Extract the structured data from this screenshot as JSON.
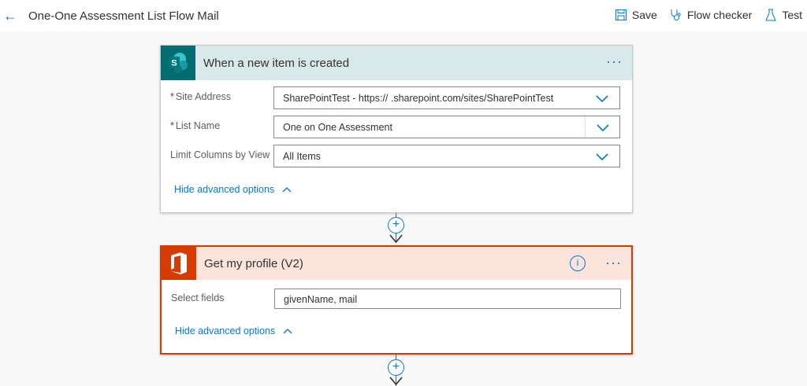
{
  "header": {
    "title": "One-One Assessment List Flow Mail",
    "save": "Save",
    "flow_checker": "Flow checker",
    "test": "Test"
  },
  "trigger": {
    "title": "When a new item is created",
    "more": "···",
    "fields": [
      {
        "label": "Site Address",
        "required": "*",
        "value": "SharePointTest - https://                  .sharepoint.com/sites/SharePointTest"
      },
      {
        "label": "List Name",
        "required": "*",
        "value": "One on One Assessment"
      },
      {
        "label": "Limit Columns by View",
        "value": "All Items"
      }
    ],
    "hide_advanced": "Hide advanced options"
  },
  "action": {
    "title": "Get my profile (V2)",
    "info": "i",
    "more": "···",
    "fields": [
      {
        "label": "Select fields",
        "value": "givenName, mail"
      }
    ],
    "hide_advanced": "Hide advanced options"
  },
  "colors": {
    "accent": "#0078d4",
    "sharepoint": "#036c70",
    "office": "#d83b01"
  }
}
